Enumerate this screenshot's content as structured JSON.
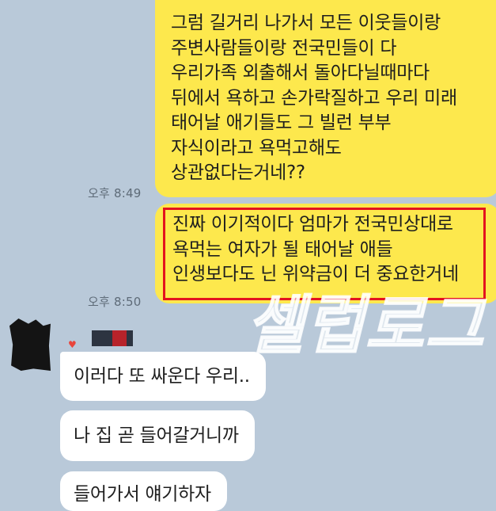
{
  "chat": {
    "outgoing": [
      {
        "lines": [
          "그럼 길거리 나가서 모든 이웃들이랑",
          "주변사람들이랑 전국민들이 다",
          "우리가족 외출해서 돌아다닐때마다",
          "뒤에서 욕하고 손가락질하고 우리 미래",
          "태어날 애기들도 그 빌런 부부",
          "자식이라고 욕먹고해도",
          "상관없다는거네??"
        ],
        "time": "오후 8:49"
      },
      {
        "lines": [
          "진짜 이기적이다 엄마가 전국민상대로",
          "욕먹는 여자가 될 태어날 애들",
          "인생보다도 닌 위약금이 더 중요한거네"
        ],
        "time": "오후 8:50"
      }
    ],
    "incoming": [
      {
        "text": "이러다 또 싸운다 우리.."
      },
      {
        "text": "나 집 곧 들어갈거니까"
      },
      {
        "text": "들어가서 얘기하자"
      }
    ]
  },
  "watermark": {
    "text": "셀럽로그"
  },
  "colors": {
    "background": "#b9c9d9",
    "outgoing_bubble": "#fde84d",
    "incoming_bubble": "#ffffff",
    "highlight_border": "#e3131f",
    "timestamp": "#5e6b78"
  }
}
